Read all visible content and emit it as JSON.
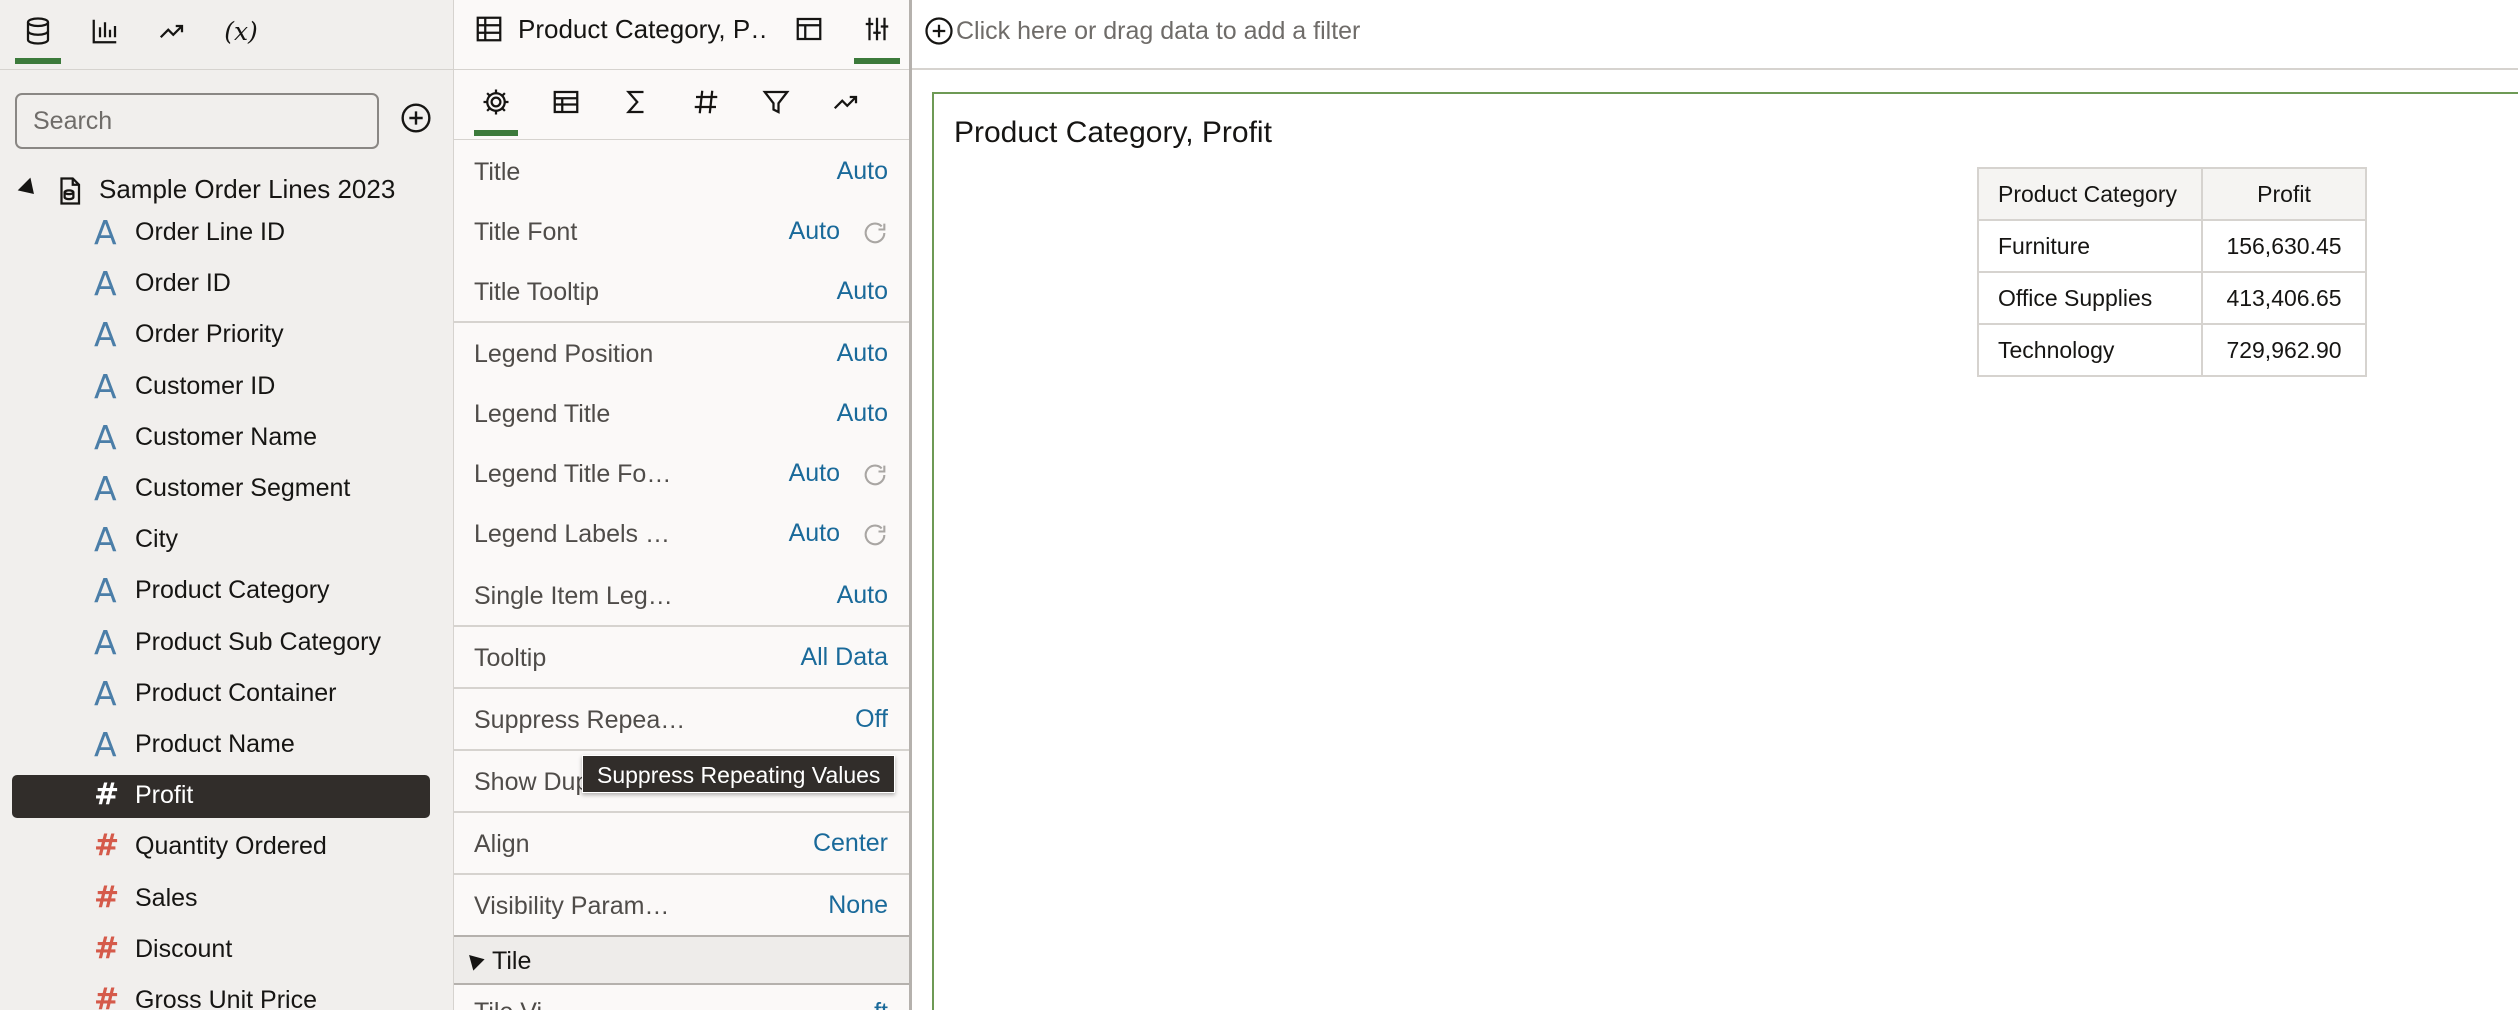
{
  "left_panel": {
    "tabs": [
      {
        "name": "data-icon"
      },
      {
        "name": "visualizations-icon"
      },
      {
        "name": "analytics-icon"
      },
      {
        "name": "calculations-icon",
        "label": "(x)"
      }
    ],
    "search": {
      "placeholder": "Search"
    },
    "dataset": {
      "name": "Sample Order Lines 2023",
      "columns": [
        {
          "label": "Order Line ID",
          "type": "attribute"
        },
        {
          "label": "Order ID",
          "type": "attribute"
        },
        {
          "label": "Order Priority",
          "type": "attribute"
        },
        {
          "label": "Customer ID",
          "type": "attribute"
        },
        {
          "label": "Customer Name",
          "type": "attribute"
        },
        {
          "label": "Customer Segment",
          "type": "attribute"
        },
        {
          "label": "City",
          "type": "attribute"
        },
        {
          "label": "Product Category",
          "type": "attribute"
        },
        {
          "label": "Product Sub Category",
          "type": "attribute"
        },
        {
          "label": "Product Container",
          "type": "attribute"
        },
        {
          "label": "Product Name",
          "type": "attribute"
        },
        {
          "label": "Profit",
          "type": "measure",
          "selected": true
        },
        {
          "label": "Quantity Ordered",
          "type": "measure"
        },
        {
          "label": "Sales",
          "type": "measure"
        },
        {
          "label": "Discount",
          "type": "measure"
        },
        {
          "label": "Gross Unit Price",
          "type": "measure"
        }
      ]
    },
    "icons": {
      "attribute": "A",
      "measure": "#"
    }
  },
  "properties_panel": {
    "viz_title": "Product Category, P…",
    "tabs": [
      "general-icon",
      "table-icon",
      "sigma-icon",
      "number-icon",
      "filter-icon",
      "analytics-icon"
    ],
    "rows": [
      {
        "key": "Title",
        "value": "Auto"
      },
      {
        "key": "Title Font",
        "value": "Auto",
        "reset": true
      },
      {
        "key": "Title Tooltip",
        "value": "Auto"
      },
      {
        "key": "Legend Position",
        "value": "Auto"
      },
      {
        "key": "Legend Title",
        "value": "Auto"
      },
      {
        "key": "Legend Title Fo…",
        "value": "Auto",
        "reset": true
      },
      {
        "key": "Legend Labels …",
        "value": "Auto",
        "reset": true
      },
      {
        "key": "Single Item Leg…",
        "value": "Auto"
      },
      {
        "key": "Tooltip",
        "value": "All Data"
      },
      {
        "key": "Suppress Repea…",
        "value": "Off"
      },
      {
        "key": "Show Dup",
        "value": ""
      },
      {
        "key": "Align",
        "value": "Center"
      },
      {
        "key": "Visibility Param…",
        "value": "None"
      }
    ],
    "section": "Tile",
    "cut_row": {
      "key": "Tile Vi…",
      "value": "…ft"
    },
    "tooltip": "Suppress Repeating Values"
  },
  "filter_bar": {
    "text": "Click here or drag data to add a filter"
  },
  "canvas": {
    "viz_title": "Product Category, Profit",
    "table": {
      "headers": [
        "Product Category",
        "Profit"
      ],
      "rows": [
        [
          "Furniture",
          "156,630.45"
        ],
        [
          "Office Supplies",
          "413,406.65"
        ],
        [
          "Technology",
          "729,962.90"
        ]
      ]
    }
  },
  "colors": {
    "accent": "#3c7a3b",
    "link": "#1a6a9a",
    "attribute_icon": "#4b7ea8",
    "measure_icon": "#d55a4a",
    "selected_bg": "#312d2a"
  }
}
